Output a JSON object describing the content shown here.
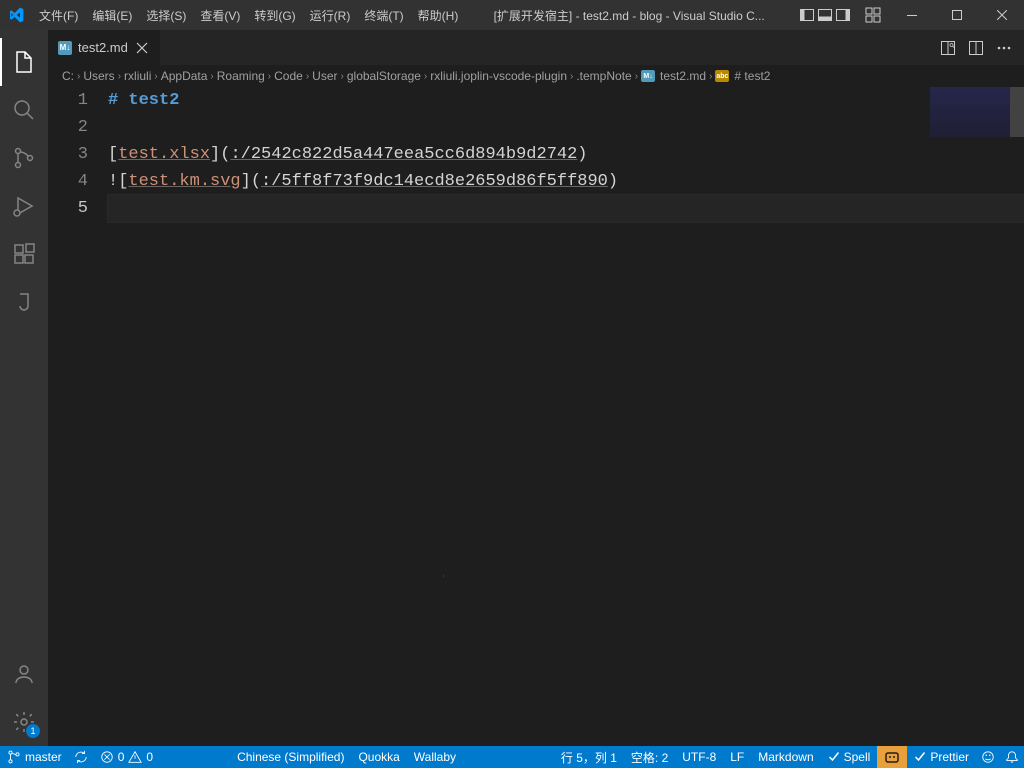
{
  "menubar": {
    "items": [
      "文件(F)",
      "编辑(E)",
      "选择(S)",
      "查看(V)",
      "转到(G)",
      "运行(R)",
      "终端(T)",
      "帮助(H)"
    ]
  },
  "window_title": "[扩展开发宿主] - test2.md - blog - Visual Studio C...",
  "tab": {
    "name": "test2.md",
    "icon_text": "M↓"
  },
  "breadcrumbs": [
    "C:",
    "Users",
    "rxliuli",
    "AppData",
    "Roaming",
    "Code",
    "User",
    "globalStorage",
    "rxliuli.joplin-vscode-plugin",
    ".tempNote",
    "test2.md",
    "# test2"
  ],
  "code": {
    "lines": [
      {
        "n": 1,
        "type": "heading",
        "text": "# test2"
      },
      {
        "n": 2,
        "type": "blank",
        "text": ""
      },
      {
        "n": 3,
        "type": "link",
        "prefix": "",
        "label": "test.xlsx",
        "url": ":/2542c822d5a447eea5cc6d894b9d2742"
      },
      {
        "n": 4,
        "type": "link",
        "prefix": "!",
        "label": "test.km.svg",
        "url": ":/5ff8f73f9dc14ecd8e2659d86f5ff890"
      },
      {
        "n": 5,
        "type": "blank",
        "text": ""
      }
    ]
  },
  "statusbar": {
    "branch": "master",
    "errors": "0",
    "warnings": "0",
    "lang": "Chinese (Simplified)",
    "quokka": "Quokka",
    "wallaby": "Wallaby",
    "cursor": "行 5，列 1",
    "spaces": "空格: 2",
    "encoding": "UTF-8",
    "eol": "LF",
    "mode": "Markdown",
    "spell": "Spell",
    "prettier": "Prettier"
  },
  "settings_badge": "1"
}
